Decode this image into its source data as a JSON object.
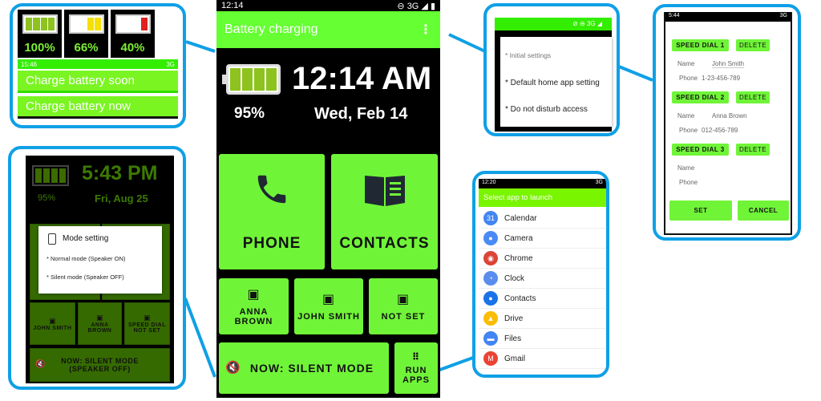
{
  "main_phone": {
    "status_time": "12:14",
    "status_right": "3G",
    "appbar_title": "Battery charging",
    "battery_percent": "95%",
    "clock": "12:14 AM",
    "date": "Wed, Feb 14",
    "tiles": {
      "phone": "PHONE",
      "contacts": "CONTACTS",
      "speed1": "ANNA BROWN",
      "speed2": "JOHN SMITH",
      "speed3": "NOT SET",
      "mode": "NOW: SILENT MODE",
      "apps": "RUN APPS"
    }
  },
  "battery_callout": {
    "levels": [
      {
        "label": "100%",
        "cells": 4,
        "color": "#8dc21f"
      },
      {
        "label": "66%",
        "cells": 2,
        "color": "#f5e000"
      },
      {
        "label": "40%",
        "cells": 1,
        "color": "#e02020"
      }
    ],
    "status_time": "15:46",
    "status_right": "3G",
    "notice_soon": "Charge battery soon",
    "notice_now": "Charge battery now"
  },
  "mode_callout": {
    "clock": "5:43 PM",
    "date": "Fri, Aug 25",
    "battery_percent": "95%",
    "dialog_title": "Mode setting",
    "option_normal": "* Normal mode (Speaker ON)",
    "option_silent": "* Silent mode (Speaker OFF)",
    "tiles": {
      "speed1": "JOHN SMITH",
      "speed2": "ANNA BROWN",
      "speed3": "SPEED DIAL NOT SET",
      "mode": "NOW: SILENT MODE (SPEAKER OFF)"
    }
  },
  "settings_callout": {
    "status_right": "3G",
    "item_initial": "* Initial settings",
    "item_home": "* Default home app setting",
    "item_dnd": "* Do not disturb access"
  },
  "speed_dial_callout": {
    "status_time": "5:44",
    "status_right": "3G",
    "entries": [
      {
        "title": "SPEED DIAL 1",
        "delete": "DELETE",
        "name_label": "Name",
        "name": "John Smith",
        "phone_label": "Phone",
        "phone": "1-23-456-789"
      },
      {
        "title": "SPEED DIAL 2",
        "delete": "DELETE",
        "name_label": "Name",
        "name": "Anna Brown",
        "phone_label": "Phone",
        "phone": "012-456-789"
      },
      {
        "title": "SPEED DIAL 3",
        "delete": "DELETE",
        "name_label": "Name",
        "name": "",
        "phone_label": "Phone",
        "phone": ""
      }
    ],
    "set": "SET",
    "cancel": "CANCEL"
  },
  "apps_callout": {
    "status_time": "12:20",
    "status_right": "3G",
    "title": "Select app to launch",
    "apps": [
      {
        "name": "Calendar",
        "color": "#4285f4",
        "glyph": "31"
      },
      {
        "name": "Camera",
        "color": "#4a8af4",
        "glyph": "●"
      },
      {
        "name": "Chrome",
        "color": "#db4437",
        "glyph": "◉"
      },
      {
        "name": "Clock",
        "color": "#5b8def",
        "glyph": "◔"
      },
      {
        "name": "Contacts",
        "color": "#1a73e8",
        "glyph": "●"
      },
      {
        "name": "Drive",
        "color": "#fbbc04",
        "glyph": "▲"
      },
      {
        "name": "Files",
        "color": "#4285f4",
        "glyph": "▬"
      },
      {
        "name": "Gmail",
        "color": "#ea4335",
        "glyph": "M"
      }
    ]
  }
}
